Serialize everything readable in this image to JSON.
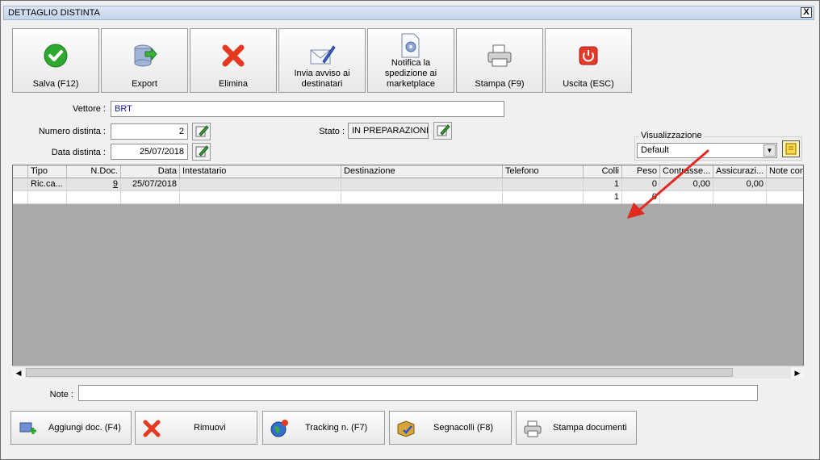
{
  "window": {
    "title": "DETTAGLIO DISTINTA",
    "close_label": "X"
  },
  "toolbar": [
    {
      "label": "Salva (F12)",
      "icon": "check-icon"
    },
    {
      "label": "Export",
      "icon": "database-export-icon"
    },
    {
      "label": "Elimina",
      "icon": "delete-x-icon"
    },
    {
      "label": "Invia avviso ai destinatari",
      "icon": "envelope-pen-icon"
    },
    {
      "label": "Notifica la spedizione ai marketplace",
      "icon": "document-gear-icon"
    },
    {
      "label": "Stampa (F9)",
      "icon": "printer-icon"
    },
    {
      "label": "Uscita (ESC)",
      "icon": "power-icon"
    }
  ],
  "form": {
    "vettore_label": "Vettore :",
    "vettore_value": "BRT",
    "numero_label": "Numero distinta :",
    "numero_value": "2",
    "data_label": "Data distinta :",
    "data_value": "25/07/2018",
    "stato_label": "Stato :",
    "stato_value": "IN PREPARAZIONE"
  },
  "visualizzazione": {
    "label": "Visualizzazione",
    "selected": "Default"
  },
  "grid": {
    "columns": [
      "Tipo",
      "N.Doc.",
      "Data",
      "Intestatario",
      "Destinazione",
      "Telefono",
      "Colli",
      "Peso",
      "Contrasse...",
      "Assicurazi...",
      "Note con"
    ],
    "rows": [
      [
        "Ric.ca...",
        "9",
        "25/07/2018",
        "",
        "",
        "",
        "1",
        "0",
        "0,00",
        "0,00",
        ""
      ],
      [
        "",
        "",
        "",
        "",
        "",
        "",
        "1",
        "0",
        "",
        "",
        ""
      ]
    ]
  },
  "note": {
    "label": "Note :",
    "value": ""
  },
  "bottom_buttons": [
    {
      "label": "Aggiungi doc. (F4)",
      "icon": "add-document-icon"
    },
    {
      "label": "Rimuovi",
      "icon": "remove-x-icon"
    },
    {
      "label": "Tracking n. (F7)",
      "icon": "globe-icon"
    },
    {
      "label": "Segnacolli (F8)",
      "icon": "package-check-icon"
    },
    {
      "label": "Stampa documenti",
      "icon": "printer-icon"
    }
  ],
  "colors": {
    "accent_green": "#2ea82e",
    "delete_red": "#e53a1f",
    "arrow_red": "#e32a20",
    "grid_empty": "#a9a9a9",
    "vettore_text": "#1a1aa0"
  }
}
